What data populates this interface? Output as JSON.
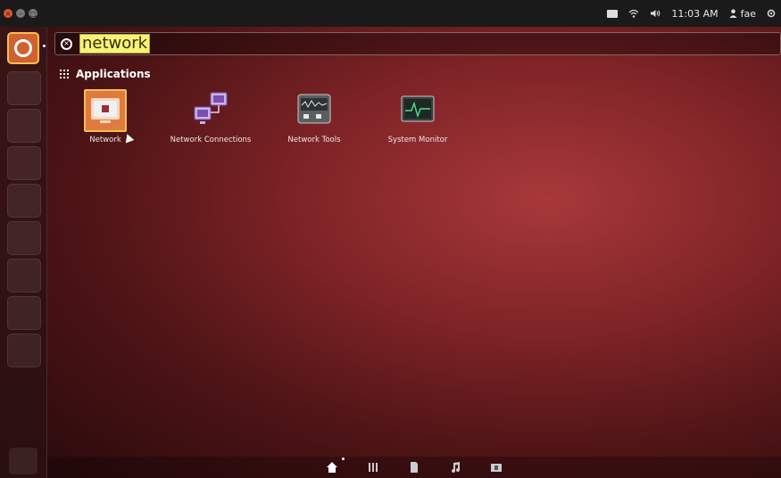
{
  "panel": {
    "time": "11:03 AM",
    "user": "fae"
  },
  "search": {
    "query": "network"
  },
  "section": {
    "title": "Applications"
  },
  "apps": [
    {
      "label": "Network"
    },
    {
      "label": "Network Connections"
    },
    {
      "label": "Network Tools"
    },
    {
      "label": "System Monitor"
    }
  ],
  "colors": {
    "selection": "#f2c14e",
    "dash_bg": "#7e2326",
    "launcher_bfb": "#d0622f"
  },
  "lenses": [
    "home-lens-icon",
    "applications-lens-icon",
    "files-lens-icon",
    "music-lens-icon",
    "video-lens-icon"
  ]
}
